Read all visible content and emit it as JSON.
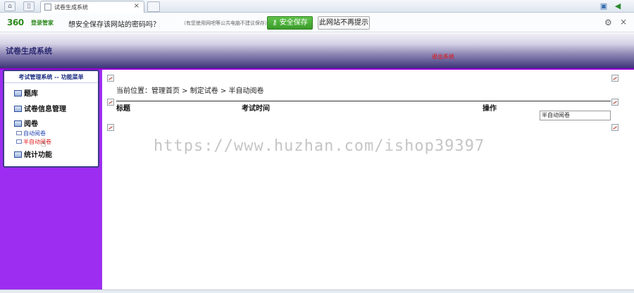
{
  "browser": {
    "tab_title": "试卷生成系统",
    "tab_close": "×"
  },
  "password_bar": {
    "logo": "360",
    "logo_sub": "登录管家",
    "question": "想安全保存该网站的密码吗？",
    "hint": "（有您使用网吧等公共电脑不建议保存）",
    "save_label": "安全保存",
    "never_label": "此网站不再提示",
    "gear": "⚙",
    "close": "×"
  },
  "banner": {
    "title": "试卷生成系统",
    "link": "退出系统"
  },
  "menu": {
    "header": "考试管理系统 -- 功能菜单",
    "items": [
      {
        "label": "题库"
      },
      {
        "label": "试卷信息管理"
      },
      {
        "label": "阅卷"
      },
      {
        "label": "统计功能"
      }
    ],
    "subitems": [
      {
        "label": "自动阅卷"
      },
      {
        "label": "半自动阅卷"
      }
    ]
  },
  "main": {
    "breadcrumb": "当前位置：管理首页 > 制定试卷 > 半自动阅卷",
    "columns": [
      "标题",
      "考试时间",
      "操作"
    ],
    "action_button": "半自动阅卷"
  },
  "watermark": "https://www.huzhan.com/ishop39397",
  "colors": {
    "sidebar": "#9d2df0",
    "banner_dark": "#3d3478",
    "save_green": "#3a9c2a",
    "active_link": "#e01b1b"
  }
}
